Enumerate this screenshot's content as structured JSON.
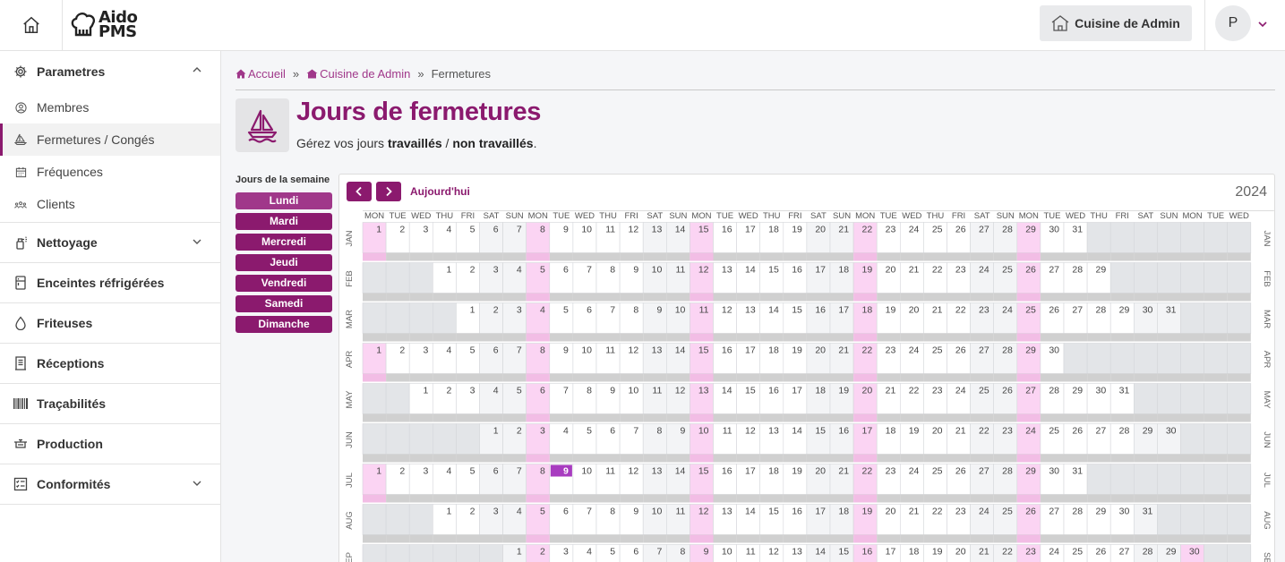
{
  "topbar": {
    "logo": {
      "line1": "Aido",
      "line2": "PMS"
    },
    "site_button_label": "Cuisine de Admin",
    "user_initial": "P"
  },
  "sidebar": {
    "group": {
      "label": "Parametres",
      "items": [
        {
          "label": "Membres",
          "icon": "user-circle-icon",
          "active": false
        },
        {
          "label": "Fermetures / Congés",
          "icon": "boat-icon",
          "active": true
        },
        {
          "label": "Fréquences",
          "icon": "calendar-icon",
          "active": false
        },
        {
          "label": "Clients",
          "icon": "users-icon",
          "active": false
        }
      ]
    },
    "sections": [
      {
        "label": "Nettoyage",
        "icon": "spray-icon",
        "chevron": true
      },
      {
        "label": "Enceintes réfrigérées",
        "icon": "fridge-icon",
        "chevron": false
      },
      {
        "label": "Friteuses",
        "icon": "drop-icon",
        "chevron": false
      },
      {
        "label": "Réceptions",
        "icon": "receipt-icon",
        "chevron": false
      },
      {
        "label": "Traçabilités",
        "icon": "barcode-icon",
        "chevron": false
      },
      {
        "label": "Production",
        "icon": "cooking-pot-icon",
        "chevron": false
      },
      {
        "label": "Conformités",
        "icon": "checklist-icon",
        "chevron": true
      }
    ]
  },
  "breadcrumb": {
    "home": "Accueil",
    "site": "Cuisine de Admin",
    "current": "Fermetures",
    "separator": "»"
  },
  "page": {
    "title": "Jours de fermetures",
    "subtitle_prefix": "Gérez vos jours ",
    "subtitle_bold1": "travaillés",
    "subtitle_sep": " / ",
    "subtitle_bold2": "non travaillés",
    "subtitle_suffix": "."
  },
  "weekday_panel": {
    "title": "Jours de la semaine",
    "days": [
      "Lundi",
      "Mardi",
      "Mercredi",
      "Jeudi",
      "Vendredi",
      "Samedi",
      "Dimanche"
    ],
    "selected": "Lundi"
  },
  "calendar": {
    "today_label": "Aujourd'hui",
    "year": "2024",
    "weekday_headers": [
      "MON",
      "TUE",
      "WED",
      "THU",
      "FRI",
      "SAT",
      "SUN",
      "MON",
      "TUE",
      "WED",
      "THU",
      "FRI",
      "SAT",
      "SUN",
      "MON",
      "TUE",
      "WED",
      "THU",
      "FRI",
      "SAT",
      "SUN",
      "MON",
      "TUE",
      "WED",
      "THU",
      "FRI",
      "SAT",
      "SUN",
      "MON",
      "TUE",
      "WED",
      "THU",
      "FRI",
      "SAT",
      "SUN",
      "MON",
      "TUE",
      "WED"
    ],
    "highlighted_weekday": "MON",
    "today": {
      "month": "JUL",
      "day": 9
    },
    "months": [
      {
        "label": "JAN",
        "offset": 0,
        "days": 31
      },
      {
        "label": "FEB",
        "offset": 3,
        "days": 29
      },
      {
        "label": "MAR",
        "offset": 4,
        "days": 31
      },
      {
        "label": "APR",
        "offset": 0,
        "days": 30
      },
      {
        "label": "MAY",
        "offset": 2,
        "days": 31
      },
      {
        "label": "JUN",
        "offset": 5,
        "days": 30
      },
      {
        "label": "JUL",
        "offset": 0,
        "days": 31
      },
      {
        "label": "AUG",
        "offset": 3,
        "days": 31
      },
      {
        "label": "SEP",
        "offset": 6,
        "days": 30
      }
    ]
  },
  "colors": {
    "brand": "#8b1a6e",
    "brand_light": "#a0388a",
    "closed_day": "#fbd4f3",
    "closed_day_strip": "#f2bde5",
    "weekend": "#f3f4f6",
    "empty_cell": "#e3e5e8",
    "strip": "#d0d0d0",
    "today_bg": "#a83cc0"
  }
}
